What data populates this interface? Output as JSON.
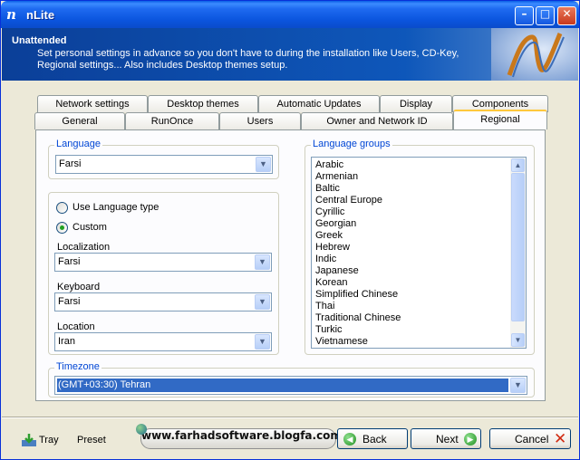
{
  "window": {
    "title": "nLite"
  },
  "header": {
    "title": "Unattended",
    "description": "Set personal settings in advance so you don't have to during the installation like Users, CD-Key, Regional settings... Also includes Desktop themes setup."
  },
  "tabs": {
    "row_back": [
      "Network settings",
      "Desktop themes",
      "Automatic Updates",
      "Display",
      "Components"
    ],
    "row_front": [
      "General",
      "RunOnce",
      "Users",
      "Owner and Network ID",
      "Regional"
    ],
    "active": "Regional"
  },
  "language": {
    "label": "Language",
    "value": "Farsi"
  },
  "mode": {
    "use_language_type": "Use Language type",
    "custom": "Custom",
    "selected": "Custom"
  },
  "localization": {
    "label": "Localization",
    "value": "Farsi"
  },
  "keyboard": {
    "label": "Keyboard",
    "value": "Farsi"
  },
  "location": {
    "label": "Location",
    "value": "Iran"
  },
  "language_groups": {
    "label": "Language groups",
    "items": [
      "Arabic",
      "Armenian",
      "Baltic",
      "Central Europe",
      "Cyrillic",
      "Georgian",
      "Greek",
      "Hebrew",
      "Indic",
      "Japanese",
      "Korean",
      "Simplified Chinese",
      "Thai",
      "Traditional Chinese",
      "Turkic",
      "Vietnamese"
    ]
  },
  "timezone": {
    "label": "Timezone",
    "value": "(GMT+03:30) Tehran"
  },
  "footer": {
    "tray": "Tray",
    "preset": "Preset",
    "website": "www.farhadsoftware.blogfa.com",
    "back": "Back",
    "next": "Next",
    "cancel": "Cancel"
  },
  "colors": {
    "title_bar": "#0B55DE",
    "group_label": "#0046D5",
    "header_bg": "#0C4AA6",
    "selection": "#316AC5"
  }
}
